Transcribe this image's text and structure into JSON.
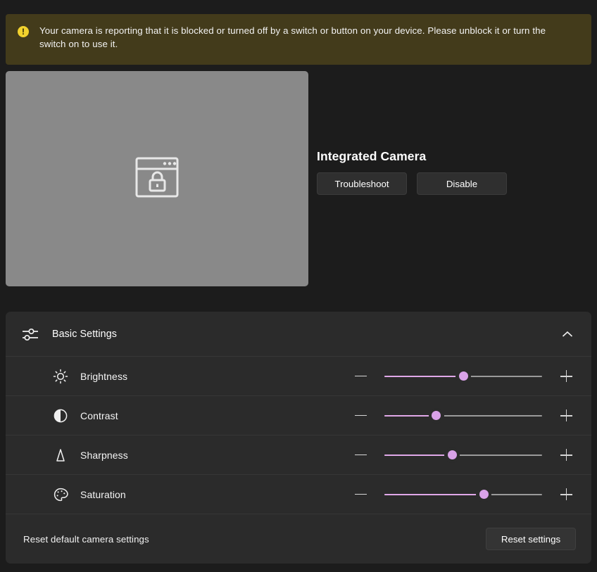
{
  "banner": {
    "icon": "warning-circle-icon",
    "text": "Your camera is reporting that it is blocked or turned off by a switch or button on your device. Please unblock it or turn the switch on to use it.",
    "background_color": "#433b1b",
    "icon_color": "#f2d22e"
  },
  "preview": {
    "icon": "blocked-camera-window-lock-icon",
    "background_color": "#898989"
  },
  "device": {
    "name": "Integrated Camera",
    "buttons": [
      {
        "label": "Troubleshoot",
        "name": "troubleshoot-button"
      },
      {
        "label": "Disable",
        "name": "disable-button"
      }
    ]
  },
  "basic_settings": {
    "icon": "sliders-icon",
    "title": "Basic Settings",
    "expanded_chevron": "chevron-up-icon",
    "decrease_icon": "minus-icon",
    "increase_icon": "plus-icon",
    "accent_color": "#e0a8e8",
    "rows": [
      {
        "label": "Brightness",
        "icon": "brightness-sun-icon",
        "value": 50
      },
      {
        "label": "Contrast",
        "icon": "contrast-half-circle-icon",
        "value": 33
      },
      {
        "label": "Sharpness",
        "icon": "sharpness-triangle-icon",
        "value": 43
      },
      {
        "label": "Saturation",
        "icon": "saturation-palette-icon",
        "value": 63
      }
    ]
  },
  "reset": {
    "label": "Reset default camera settings",
    "button_label": "Reset settings"
  }
}
